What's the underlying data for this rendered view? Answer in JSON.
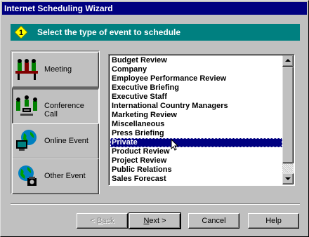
{
  "window": {
    "title": "Internet Scheduling Wizard"
  },
  "step": {
    "number": "1",
    "title": "Select the type of event to schedule"
  },
  "event_types": [
    {
      "label": "Meeting",
      "icon": "meeting-icon",
      "pressed": false
    },
    {
      "label": "Conference Call",
      "icon": "conference-call-icon",
      "pressed": true
    },
    {
      "label": "Online Event",
      "icon": "online-event-icon",
      "pressed": false
    },
    {
      "label": "Other Event",
      "icon": "other-event-icon",
      "pressed": false
    }
  ],
  "event_list": {
    "selected": "Private",
    "items": [
      "Budget Review",
      "Company",
      "Employee Performance Review",
      "Executive Briefing",
      "Executive Staff",
      "International Country Managers",
      "Marketing Review",
      "Miscellaneous",
      "Press Briefing",
      "Private",
      "Product Review",
      "Project Review",
      "Public Relations",
      "Sales Forecast"
    ]
  },
  "buttons": {
    "back": {
      "prefix": "< ",
      "mnemonic": "B",
      "rest": "ack",
      "enabled": false
    },
    "next": {
      "mnemonic": "N",
      "rest": "ext >",
      "default": true
    },
    "cancel": "Cancel",
    "help": "Help"
  },
  "colors": {
    "title_bar": "#000080",
    "step_banner": "#008080",
    "step_badge": "#ffff00",
    "selection": "#000080",
    "face": "#c0c0c0"
  }
}
